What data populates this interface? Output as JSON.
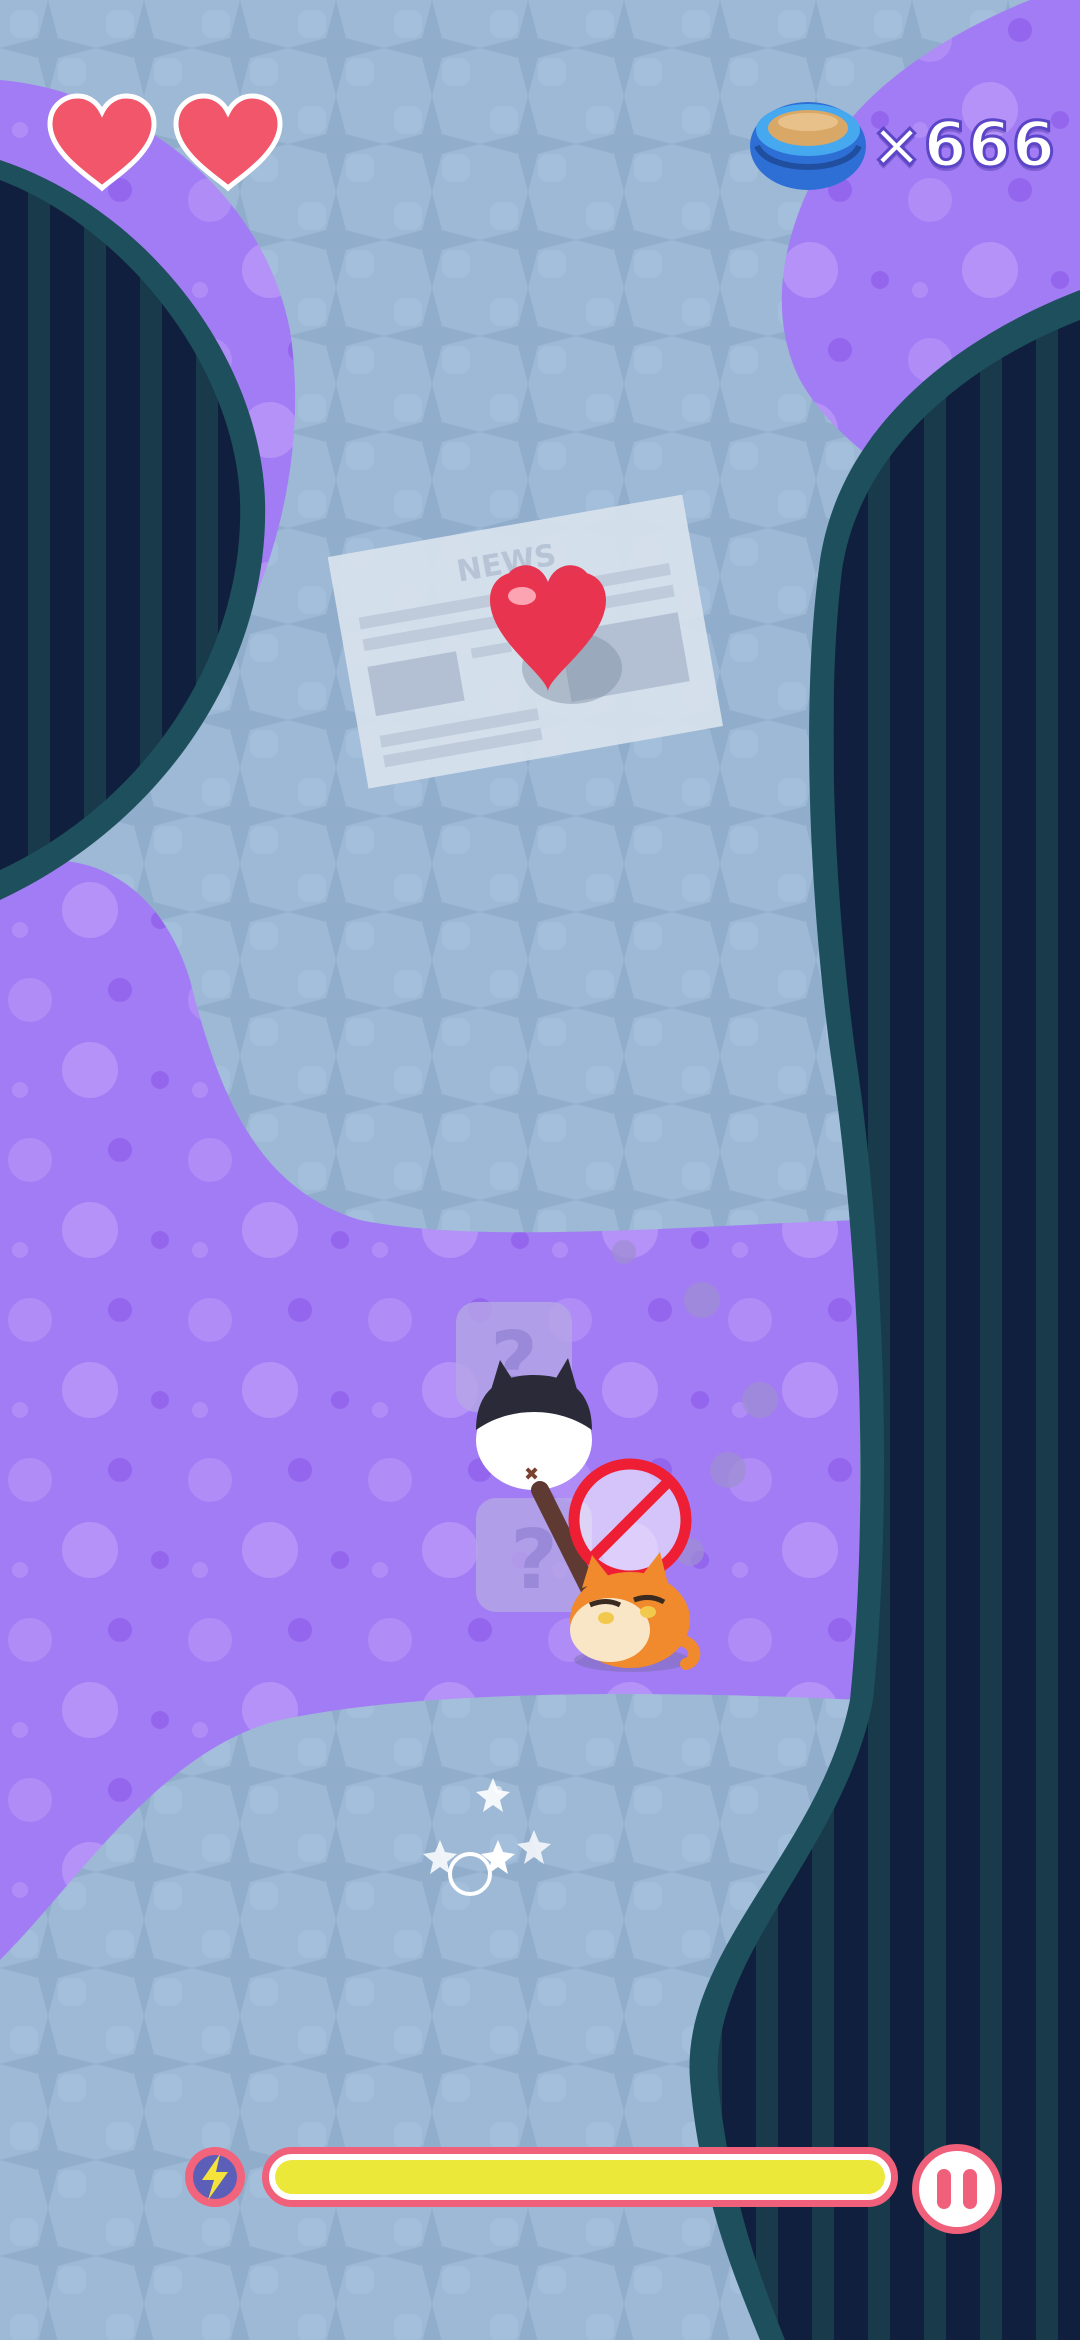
{
  "hud": {
    "lives": {
      "current": 2,
      "max": 2,
      "color": "#f2566a"
    },
    "coin_count": "×666",
    "coin_icon": "food-bowl-icon",
    "energy": {
      "icon": "lightning-icon",
      "fill_fraction": 1.0,
      "fill_color": "#ebe839",
      "border_color": "#f0607a"
    },
    "pause_icon": "pause-icon"
  },
  "world": {
    "floor_color": "#9db9d6",
    "carpet_color": "#a27cf4",
    "wall_color": "#0f1f3d",
    "newspaper_headline": "NEWS",
    "pickup": "heart-pickup",
    "mystery_block_label": "?",
    "characters": [
      "black-white-cat",
      "orange-cat"
    ],
    "forbidden_sign_icon": "no-entry-icon"
  }
}
